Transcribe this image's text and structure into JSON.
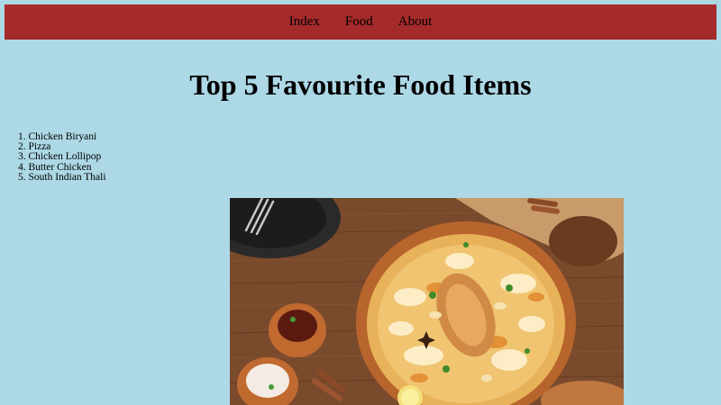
{
  "nav": {
    "links": [
      "Index",
      "Food",
      "About"
    ]
  },
  "page": {
    "title": "Top 5 Favourite Food Items"
  },
  "food_list": [
    "1. Chicken Biryani",
    "2. Pizza",
    "3. Chicken Lollipop",
    "4. Butter Chicken",
    "5. South Indian Thali"
  ],
  "colors": {
    "background": "#add8e6",
    "navbar": "#a52a2a"
  },
  "image": {
    "alt": "Chicken Biryani in a clay pot on a wooden table"
  }
}
